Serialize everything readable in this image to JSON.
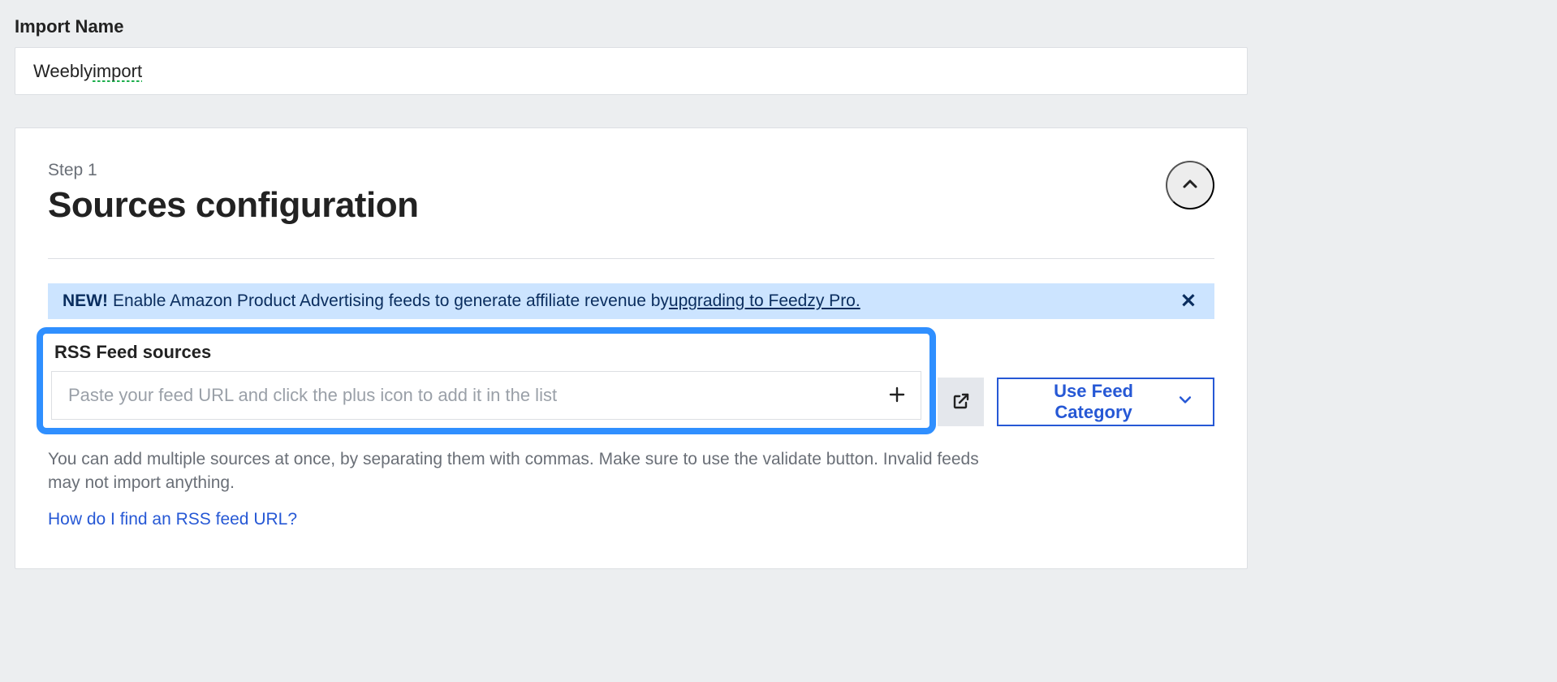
{
  "header": {
    "import_name_label": "Import Name",
    "import_name_value_a": "Weebly ",
    "import_name_value_b": "import"
  },
  "step": {
    "label": "Step 1",
    "title": "Sources configuration"
  },
  "notice": {
    "badge": "NEW!",
    "text": " Enable Amazon Product Advertising feeds to generate affiliate revenue by ",
    "link_text": "upgrading to Feedzy Pro."
  },
  "sources": {
    "label": "RSS Feed sources",
    "placeholder": "Paste your feed URL and click the plus icon to add it in the list",
    "use_category_label": "Use Feed Category",
    "hint": "You can add multiple sources at once, by separating them with commas. Make sure to use the validate button. Invalid feeds may not import anything.",
    "help_link": "How do I find an RSS feed URL?"
  },
  "icons": {
    "collapse": "chevron-up-icon",
    "close": "close-icon",
    "plus": "plus-icon",
    "external": "external-link-icon",
    "chevron_down": "chevron-down-icon"
  }
}
